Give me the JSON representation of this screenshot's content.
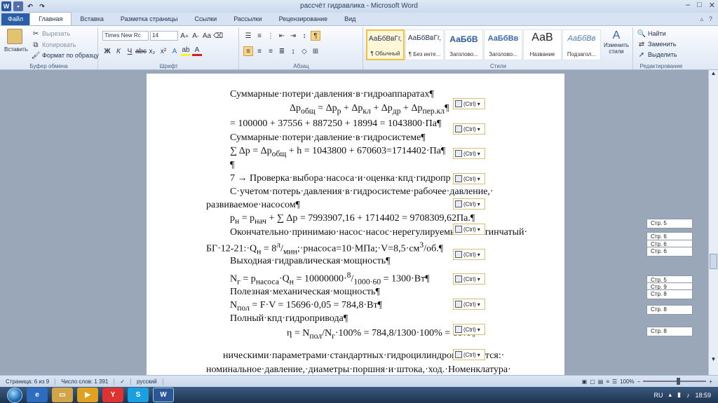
{
  "window": {
    "title": "рассчёт гидравлика - Microsoft Word",
    "logo": "W"
  },
  "tabs": [
    {
      "label": "Файл"
    },
    {
      "label": "Главная"
    },
    {
      "label": "Вставка"
    },
    {
      "label": "Разметка страницы"
    },
    {
      "label": "Ссылки"
    },
    {
      "label": "Рассылки"
    },
    {
      "label": "Рецензирование"
    },
    {
      "label": "Вид"
    }
  ],
  "ribbon": {
    "clipboard": {
      "paste": "Вставить",
      "cut": "Вырезать",
      "copy": "Копировать",
      "format_painter": "Формат по образцу",
      "label": "Буфер обмена"
    },
    "font": {
      "name": "Times New Rc",
      "size": "14",
      "label": "Шрифт"
    },
    "paragraph": {
      "label": "Абзац"
    },
    "styles": {
      "label": "Стили",
      "items": [
        {
          "preview": "АаБбВвГг,",
          "name": "¶ Обычный"
        },
        {
          "preview": "АаБбВвГг,",
          "name": "¶ Без инте..."
        },
        {
          "preview": "АаБбВ",
          "name": "Заголово..."
        },
        {
          "preview": "АаБбВв",
          "name": "Заголово..."
        },
        {
          "preview": "АаВ",
          "name": "Название"
        },
        {
          "preview": "АаБбВв",
          "name": "Подзагол..."
        }
      ],
      "change": "Изменить стили"
    },
    "editing": {
      "find": "Найти",
      "replace": "Заменить",
      "select": "Выделить",
      "label": "Редактирование"
    }
  },
  "document": {
    "l1": "Суммарные·потери·давления·в·гидроаппаратах¶",
    "l2": "Δp<sub>общ</sub> = Δp<sub>р</sub> + Δp<sub>кл</sub> + Δp<sub>др</sub> + Δp<sub>пер.кл</sub>¶",
    "l3": "= 100000 + 37556 + 887250 + 18994 = 1043800·Па¶",
    "l4": "Суммарные·потери·давление·в·гидросистеме¶",
    "l5": "∑ Δp = Δp<sub>общ</sub> + h = 1043800 + 670603=1714402·Па¶",
    "l6": "¶",
    "l7": "7 → Проверка·выбора·насоса·и·оценка·кпд·гидропр",
    "l8": "С·учетом·потерь·давления·в·гидросистеме·рабочее·давление,·",
    "l9": "развиваемое·насосом¶",
    "l10": "p<sub>н</sub> = p<sub>нач</sub> + ∑ Δp = 7993907,16 + 1714402 = 9708309,62Па.¶",
    "l11": "Окончательно·принимаю·насос·насос·нерегулируемый·пластинчатый·",
    "l12": "БГ·12-21:·Q<sub>н</sub> = 8<sup>л</sup>/<sub>мин</sub>;·pнасоса=10·МПа;·V=8,5·см<sup>3</sup>/об.¶",
    "l13": "Выходная·гидравлическая·мощность¶",
    "l14": "N<sub>г</sub> = p<sub>насоса</sub>·Q<sub>н</sub> = 10000000·<sup>8</sup>/<sub>1000·60</sub> = 1300·Вт¶",
    "l15": "Полезная·механическая·мощность¶",
    "l16": "N<sub>пол</sub> = F·V = 15696·0,05 = 784,8·Вт¶",
    "l17": "Полный·кпд·гидропривода¶",
    "l18": "η = N<sub>пол</sub>/N<sub>г</sub>·100% = 784,8/1300·100% = 60%¶",
    "l19": "ническими·параметрами·стандартных·гидроцилиндров·являются:·",
    "l20": "номинальное·давление,·диаметры·поршня·и·штока,·ход.·Номенклатура·"
  },
  "paste_option": "(Ctrl)",
  "page_marks": [
    "Стр. 5",
    "Стр. 6",
    "Стр. 6",
    "Стр. 6",
    "Стр. 5",
    "Стр. 9",
    "Стр. 8",
    "Стр. 8",
    "Стр. 8"
  ],
  "status": {
    "page": "Страница: 6 из 9",
    "words": "Число слов: 1 391",
    "lang": "русский",
    "zoom": "100%"
  },
  "taskbar": {
    "lang": "RU",
    "time": "18:59"
  }
}
